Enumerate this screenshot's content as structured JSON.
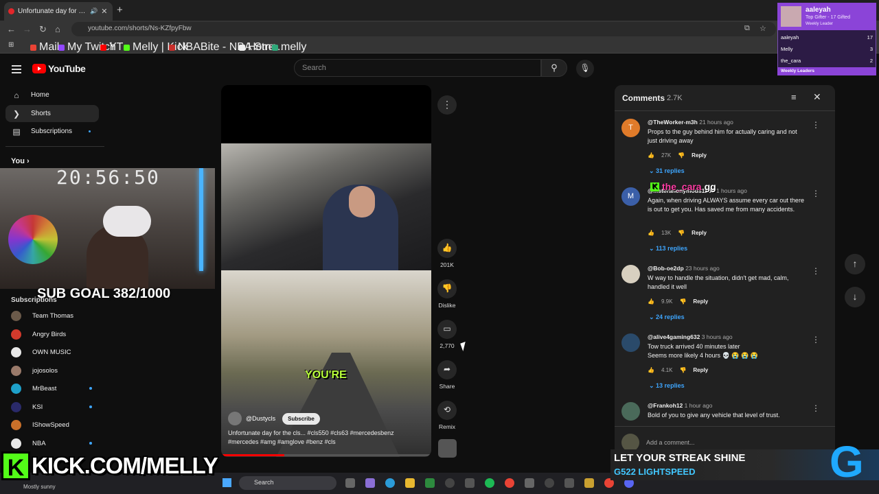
{
  "browser": {
    "tab_title": "Unfortunate day for the cls...",
    "tab_close": "✕",
    "new_tab": "+",
    "url": "youtube.com/shorts/Ns-KZfpyFbw",
    "bookmarks": [
      "Mail",
      "My Twitch",
      "YT",
      "Melly | Kick",
      "NBABite - NBA Stre...",
      "Home",
      "melly"
    ]
  },
  "youtube": {
    "logo": "YouTube",
    "search_placeholder": "Search",
    "nav": [
      {
        "label": "Home",
        "icon": "home-icon"
      },
      {
        "label": "Shorts",
        "icon": "shorts-icon"
      },
      {
        "label": "Subscriptions",
        "icon": "subscriptions-icon"
      }
    ],
    "you_label": "You",
    "subscriptions_header": "Subscriptions",
    "subscriptions": [
      {
        "name": "Team Thomas",
        "color": "#6b5a4a"
      },
      {
        "name": "Angry Birds",
        "color": "#d33a2c"
      },
      {
        "name": "OWN MUSIC",
        "color": "#e8e8e8"
      },
      {
        "name": "jojosolos",
        "color": "#9a7a6a"
      },
      {
        "name": "MrBeast",
        "color": "#1ea0c9"
      },
      {
        "name": "KSI",
        "color": "#2a2a6a"
      },
      {
        "name": "IShowSpeed",
        "color": "#c9702a"
      },
      {
        "name": "NBA",
        "color": "#e8e8e8"
      }
    ]
  },
  "stream_overlay": {
    "clock": "20:56:50",
    "sub_goal": "SUB GOAL 382/1000",
    "kick_url": "KICK.COM/MELLY",
    "kick_letter": "K",
    "chat_user": "the_cara",
    "chat_msg": "gg",
    "gifter": {
      "name": "aaleyah",
      "subtitle": "Top Gifter - 17 Gifted",
      "subtitle2": "Weekly Leader",
      "leaders": [
        {
          "name": "aaleyah",
          "count": "17"
        },
        {
          "name": "Melly",
          "count": "3"
        },
        {
          "name": "the_cara",
          "count": "2"
        }
      ],
      "footer": "Weekly Leaders"
    },
    "ad_line1": "LET YOUR STREAK SHINE",
    "ad_line2": "G522 LIGHTSPEED",
    "ad_logo": "G"
  },
  "short": {
    "caption": "YOU'RE",
    "channel": "@Dustycls",
    "subscribe": "Subscribe",
    "title": "Unfortunate day for the cls... #cls550 #cls63 #mercedesbenz #mercedes #amg #amglove #benz #cls",
    "likes": "201K",
    "dislike": "Dislike",
    "comments": "2,770",
    "share": "Share",
    "remix": "Remix"
  },
  "comments_panel": {
    "title": "Comments",
    "count": "2.7K",
    "add_placeholder": "Add a comment...",
    "items": [
      {
        "user": "@TheWorker-m3h",
        "ago": "21 hours ago",
        "text": "Props to the guy behind him for actually caring and not just driving away",
        "likes": "27K",
        "reply": "Reply",
        "replies": "31 replies",
        "initial": "T",
        "color": "#e07b2a"
      },
      {
        "user": "@...steranonymous1209",
        "ago": "1 hours ago",
        "text": "Again, when driving ALWAYS assume every car out there is out to get you. Has saved me from many accidents.",
        "likes": "13K",
        "reply": "Reply",
        "replies": "113 replies",
        "initial": "M",
        "color": "#3b5fa8"
      },
      {
        "user": "@Bob-oe2dp",
        "ago": "23 hours ago",
        "text": "W way to handle the situation, didn't get mad, calm, handled it well",
        "likes": "9.9K",
        "reply": "Reply",
        "replies": "24 replies",
        "initial": "",
        "color": "#d8d0c0"
      },
      {
        "user": "@alive4gaming632",
        "ago": "3 hours ago",
        "text": "Tow truck arrived 40 minutes later\nSeems more likely 4 hours 💀 😭 😭 😭",
        "likes": "4.1K",
        "reply": "Reply",
        "replies": "13 replies",
        "initial": "",
        "color": "#2a4a6a"
      },
      {
        "user": "@Frankoh12",
        "ago": "1 hour ago",
        "text": "Bold of you to give any vehicle that level of trust.",
        "likes": "",
        "reply": "",
        "replies": "",
        "initial": "",
        "color": "#4a6a5a"
      }
    ]
  },
  "taskbar": {
    "weather": "Mostly sunny",
    "search": "Search"
  },
  "colors": {
    "yt_red": "#ff0000",
    "kick_green": "#53fc18",
    "link_blue": "#3ea6ff",
    "gifter_purple": "#8b44d8"
  }
}
